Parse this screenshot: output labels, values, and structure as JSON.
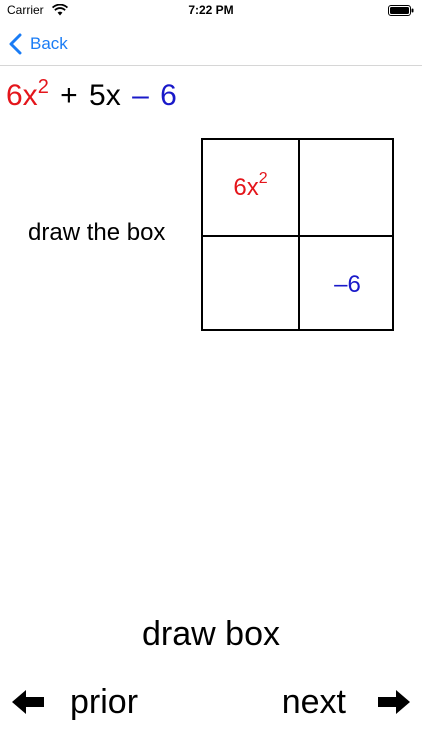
{
  "status_bar": {
    "carrier": "Carrier",
    "time": "7:22 PM",
    "icons": [
      "wifi-icon",
      "battery-icon"
    ]
  },
  "nav": {
    "back_label": "Back",
    "accent_color": "#1a7cf5"
  },
  "expression": {
    "term1_coeff": "6x",
    "term1_exp": "2",
    "op1": "+",
    "term2": "5x",
    "op2": "–",
    "term3": "6",
    "colors": {
      "term1": "#e4151b",
      "term3": "#1919c9",
      "middle": "#000000"
    }
  },
  "instruction": "draw the box",
  "box": {
    "top_left_coeff": "6x",
    "top_left_exp": "2",
    "top_right": "",
    "bottom_left": "",
    "bottom_right": "–6"
  },
  "step_title": "draw box",
  "footer": {
    "prior_label": "prior",
    "next_label": "next",
    "icons": [
      "arrow-left-icon",
      "arrow-right-icon"
    ]
  }
}
